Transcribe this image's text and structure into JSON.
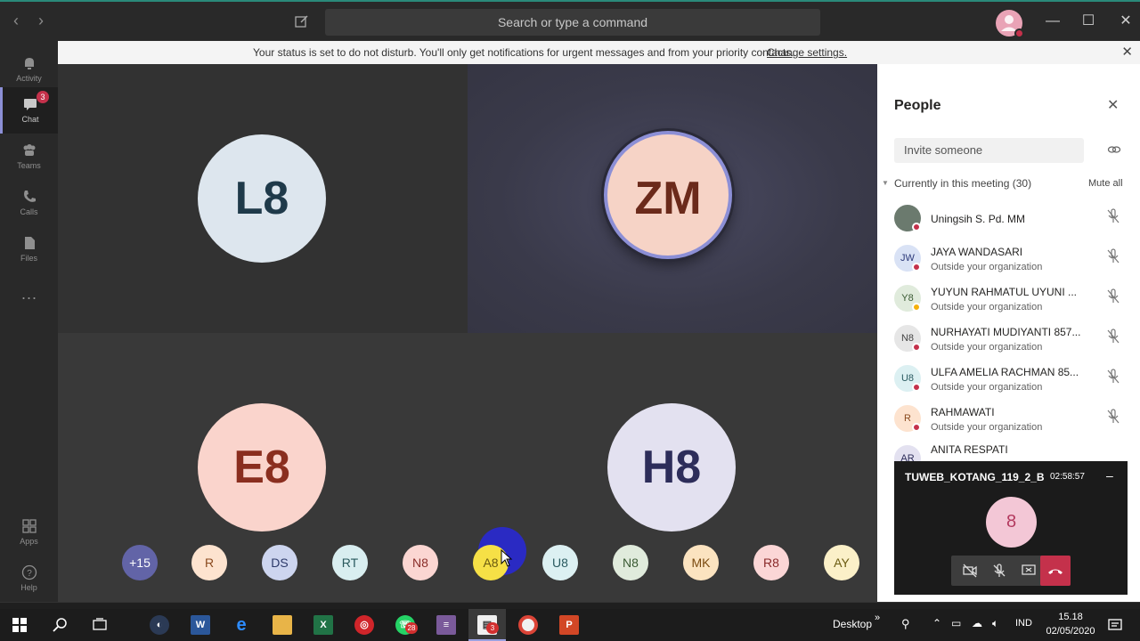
{
  "titlebar": {
    "search_placeholder": "Search or type a command"
  },
  "rail": {
    "items": [
      {
        "label": "Activity",
        "icon": "bell-icon"
      },
      {
        "label": "Chat",
        "icon": "chat-icon",
        "badge": "3"
      },
      {
        "label": "Teams",
        "icon": "teams-icon"
      },
      {
        "label": "Calls",
        "icon": "phone-icon"
      },
      {
        "label": "Files",
        "icon": "files-icon"
      },
      {
        "label": "Apps",
        "icon": "apps-icon"
      },
      {
        "label": "Help",
        "icon": "help-icon"
      }
    ]
  },
  "notification": {
    "text": "Your status is set to do not disturb. You'll only get notifications for urgent messages and from your priority contacts.",
    "link": "Change settings."
  },
  "stage": {
    "tiles": [
      {
        "initials": "L8",
        "bg": "#dde6ee",
        "fg": "#1f3a4a"
      },
      {
        "initials": "ZM",
        "bg": "#f6d3c6",
        "fg": "#6b2a1b",
        "speaking": true,
        "ring": "#8c8fd6"
      },
      {
        "initials": "E8",
        "bg": "#fad4cc",
        "fg": "#8a2e1f"
      },
      {
        "initials": "H8",
        "bg": "#e3e1f0",
        "fg": "#2d2d5a"
      }
    ],
    "strip": [
      {
        "initials": "+15",
        "bg": "#6264a7",
        "fg": "#ffffff"
      },
      {
        "initials": "R",
        "bg": "#fde3cf",
        "fg": "#8a4a1f"
      },
      {
        "initials": "DS",
        "bg": "#cdd5ef",
        "fg": "#2d3a6a"
      },
      {
        "initials": "RT",
        "bg": "#d9eef0",
        "fg": "#2a5a5e"
      },
      {
        "initials": "N8",
        "bg": "#fbd6d2",
        "fg": "#8a2e2a"
      },
      {
        "initials": "A8",
        "bg": "#f6e046",
        "fg": "#6a5a10"
      },
      {
        "initials": "U8",
        "bg": "#dcf0f2",
        "fg": "#2a5a60"
      },
      {
        "initials": "N8",
        "bg": "#e0ebdc",
        "fg": "#3a5a33"
      },
      {
        "initials": "MK",
        "bg": "#fbe3c0",
        "fg": "#7a4a10"
      },
      {
        "initials": "R8",
        "bg": "#fbd6d6",
        "fg": "#8a2a2a"
      },
      {
        "initials": "AY",
        "bg": "#fbf0c8",
        "fg": "#6a5a10"
      }
    ]
  },
  "people": {
    "title": "People",
    "invite_placeholder": "Invite someone",
    "section": "Currently in this meeting (30)",
    "mute_all": "Mute all",
    "list": [
      {
        "name": "Uningsih S. Pd. MM",
        "sub": "",
        "initials": "",
        "photo": true,
        "bg": "#6b7a6e",
        "dot": "#c4314b"
      },
      {
        "name": "JAYA WANDASARI",
        "sub": "Outside your organization",
        "initials": "JW",
        "bg": "#d9e2f5",
        "fg": "#2d3a7a",
        "dot": "#c4314b"
      },
      {
        "name": "YUYUN RAHMATUL UYUNI ...",
        "sub": "Outside your organization",
        "initials": "Y8",
        "bg": "#e0ebdc",
        "fg": "#3a5a33",
        "dot": "#f5b10a"
      },
      {
        "name": "NURHAYATI MUDIYANTI 857...",
        "sub": "Outside your organization",
        "initials": "N8",
        "bg": "#e6e6e6",
        "fg": "#444444",
        "dot": "#c4314b"
      },
      {
        "name": "ULFA AMELIA RACHMAN 85...",
        "sub": "Outside your organization",
        "initials": "U8",
        "bg": "#dcf0f2",
        "fg": "#2a5a60",
        "dot": "#c4314b"
      },
      {
        "name": "RAHMAWATI",
        "sub": "Outside your organization",
        "initials": "R",
        "bg": "#fde3cf",
        "fg": "#8a4a1f",
        "dot": "#c4314b"
      },
      {
        "name": "ANITA RESPATI",
        "sub": "",
        "initials": "AR",
        "bg": "#e3e1f0",
        "fg": "#2d2d5a",
        "dot": ""
      }
    ]
  },
  "call": {
    "title": "TUWEB_KOTANG_119_2_B",
    "time": "02:58:57",
    "avatar": "8"
  },
  "taskbar": {
    "desktop": "Desktop",
    "lang": "IND",
    "time": "15.18",
    "date": "02/05/2020",
    "whatsapp_badge": "28",
    "teams_badge": "3"
  }
}
